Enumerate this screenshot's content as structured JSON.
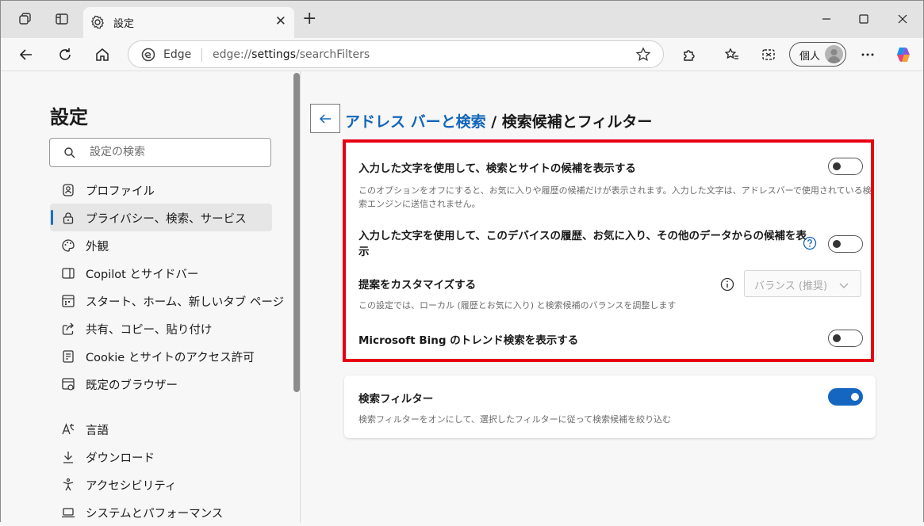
{
  "tab": {
    "title": "設定"
  },
  "address": {
    "site_label": "Edge",
    "url_prefix": "edge://",
    "url_bold": "settings",
    "url_path": "/searchFilters"
  },
  "profile": {
    "label": "個人"
  },
  "sidebar": {
    "title": "設定",
    "search_placeholder": "設定の検索",
    "items": [
      {
        "label": "プロファイル",
        "icon": "profile-icon"
      },
      {
        "label": "プライバシー、検索、サービス",
        "icon": "lock-icon",
        "active": true
      },
      {
        "label": "外観",
        "icon": "palette-icon"
      },
      {
        "label": "Copilot とサイドバー",
        "icon": "sidebar-icon"
      },
      {
        "label": "スタート、ホーム、新しいタブ ページ",
        "icon": "home-grid-icon"
      },
      {
        "label": "共有、コピー、貼り付け",
        "icon": "share-icon"
      },
      {
        "label": "Cookie とサイトのアクセス許可",
        "icon": "permissions-icon"
      },
      {
        "label": "既定のブラウザー",
        "icon": "browser-icon"
      },
      {
        "label": "言語",
        "icon": "language-icon"
      },
      {
        "label": "ダウンロード",
        "icon": "download-icon"
      },
      {
        "label": "アクセシビリティ",
        "icon": "accessibility-icon"
      },
      {
        "label": "システムとパフォーマンス",
        "icon": "laptop-icon"
      }
    ]
  },
  "breadcrumb": {
    "parent": "アドレス バーと検索",
    "separator": " / ",
    "current": "検索候補とフィルター"
  },
  "settings": {
    "suggestions_title": "入力した文字を使用して、検索とサイトの候補を表示する",
    "suggestions_desc_1": "このオプションをオフにすると、お気に入りや履歴の候補だけが表示されます。入力した文字は、アドレスバーで使用されている検",
    "suggestions_desc_2": "索エンジンに送信されません。",
    "suggestions_on": false,
    "device_title_1": "入力した文字を使用して、このデバイスの履歴、お気に入り、その他のデータからの候補を表",
    "device_title_2": "示",
    "device_on": false,
    "customize_title": "提案をカスタマイズする",
    "customize_value": "バランス (推奨)",
    "customize_desc": "この設定では、ローカル (履歴とお気に入り) と検索候補のバランスを調整します",
    "bing_title": "Microsoft Bing のトレンド検索を表示する",
    "bing_on": false,
    "filter_title": "検索フィルター",
    "filter_desc": "検索フィルターをオンにして、選択したフィルターに従って検索候補を絞り込む",
    "filter_on": true
  },
  "colors": {
    "accent": "#1566c0",
    "highlight_box": "#e60012",
    "link": "#1366b8"
  }
}
